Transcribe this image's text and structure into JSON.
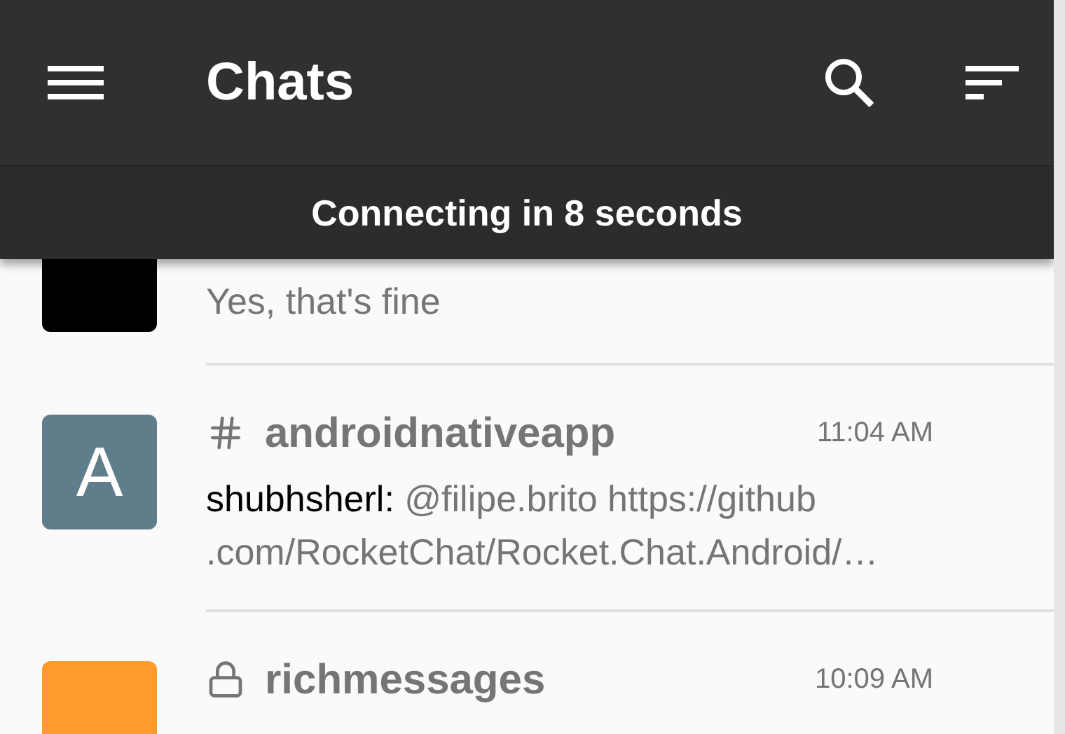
{
  "app_bar": {
    "title": "Chats"
  },
  "connection_banner": {
    "text": "Connecting in 8 seconds"
  },
  "rooms": [
    {
      "color": "#000000",
      "message": "Yes, that's fine"
    },
    {
      "kind": "channel",
      "avatar_letter": "A",
      "color": "#607d8b",
      "name": "androidnativeapp",
      "time": "11:04 AM",
      "sender": "shubhsherl:",
      "message": "@filipe.brito https://github\n.com/RocketChat/Rocket.Chat.Android/…"
    },
    {
      "kind": "private",
      "color": "#ff9a2e",
      "name": "richmessages",
      "time": "10:09 AM"
    }
  ]
}
